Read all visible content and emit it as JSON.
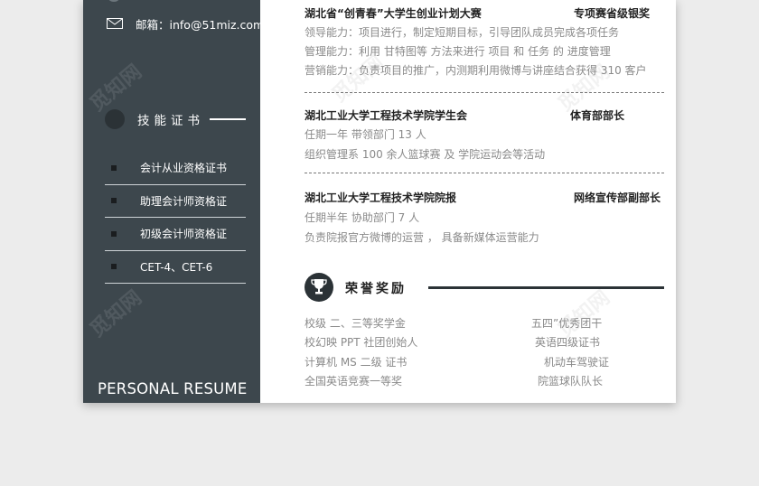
{
  "sidebar": {
    "email": "邮箱：info@51miz.com",
    "skills_title": "技能证书",
    "certs": [
      "会计从业资格证书",
      "助理会计师资格证",
      "初级会计师资格证",
      "CET-4、CET-6"
    ],
    "resume_label": "PERSONAL RESUME"
  },
  "watermark": "觅知网",
  "experience": [
    {
      "org": "湖北省“创青春”大学生创业计划大赛",
      "role": "专项赛省级银奖",
      "lines": [
        "领导能力：项目进行，制定短期目标，引导团队成员完成各项任务",
        "管理能力：利用  甘特图等   方法来进行 项目 和 任务 的 进度管理",
        "营销能力：负责项目的推广，内测期利用微博与讲座结合获得 310 客户"
      ]
    },
    {
      "org": "湖北工业大学工程技术学院学生会",
      "role": "体育部部长",
      "lines": [
        "任期一年        带领部门 13 人",
        "组织管理系 100 余人篮球赛   及    学院运动会等活动"
      ]
    },
    {
      "org": "湖北工业大学工程技术学院院报",
      "role": "网络宣传部副部长",
      "lines": [
        "任期半年        协助部门 7 人",
        "负责院报官方微博的运营    ，     具备新媒体运营能力"
      ]
    }
  ],
  "honors": {
    "title": "荣誉奖励",
    "left": [
      "校级  二、三等奖学金",
      "校幻映 PPT 社团创始人",
      "计算机 MS 二级  证书",
      "全国英语竞赛一等奖"
    ],
    "right": [
      "五四”优秀团干",
      "英语四级证书",
      "机动车驾驶证",
      "院篮球队队长"
    ]
  },
  "colors": {
    "sidebar": "#3d474d",
    "accent_dark": "#2b3236",
    "body_text": "#8a8a8a",
    "heading_text": "#222222",
    "background": "#ececec"
  }
}
